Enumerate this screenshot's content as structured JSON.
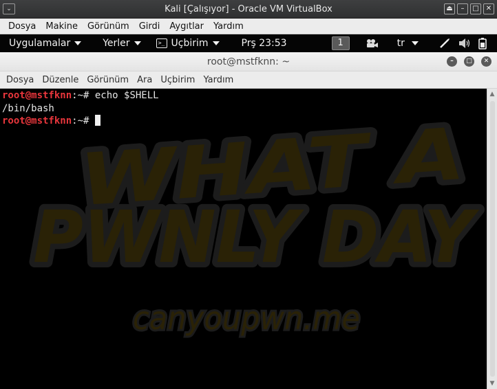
{
  "host_window": {
    "title": "Kali [Çalışıyor] - Oracle VM VirtualBox",
    "menu_icon": "⌄",
    "buttons": {
      "scale": "⏏",
      "minimize": "–",
      "maximize": "□",
      "close": "✕"
    },
    "menu": [
      "Dosya",
      "Makine",
      "Görünüm",
      "Girdi",
      "Aygıtlar",
      "Yardım"
    ]
  },
  "panel": {
    "applications": "Uygulamalar",
    "places": "Yerler",
    "app_menu": "Uçbirim",
    "app_menu_icon": ">_",
    "clock": "Prş 23:53",
    "workspace": "1",
    "keyboard_layout": "tr",
    "icons": {
      "video": "video-camera-icon",
      "pen": "pen-icon",
      "volume": "volume-icon",
      "battery": "battery-icon"
    }
  },
  "terminal": {
    "title": "root@mstfknn: ~",
    "buttons": {
      "minimize": "–",
      "maximize": "□",
      "close": "✕"
    },
    "menu": [
      "Dosya",
      "Düzenle",
      "Görünüm",
      "Ara",
      "Uçbirim",
      "Yardım"
    ],
    "lines": [
      {
        "user": "root@mstfknn",
        "rest": ":~# echo $SHELL"
      },
      {
        "output": "/bin/bash"
      },
      {
        "user": "root@mstfknn",
        "rest": ":~# "
      }
    ],
    "wallpaper": {
      "line1": "WHAT A",
      "line2": "PWNLY DAY",
      "site": "canyoupwn.me",
      "color": "#2a2206",
      "stroke": "#1c1c1c"
    }
  },
  "colors": {
    "prompt": "#e8363c",
    "terminal_bg": "#000000",
    "panel_bg": "#050505"
  }
}
